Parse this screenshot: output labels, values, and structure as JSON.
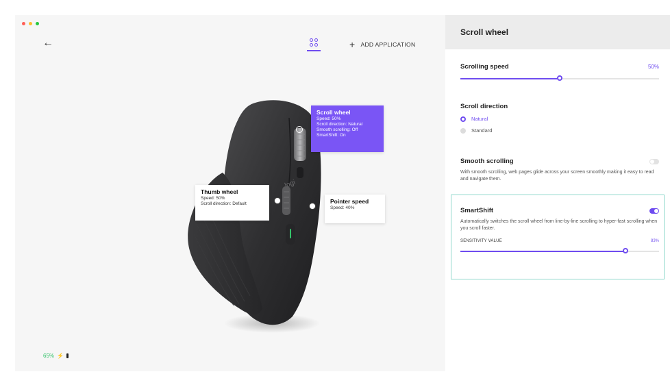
{
  "window": {
    "traffic_lights": [
      "#ff5f57",
      "#febc2e",
      "#28c840"
    ]
  },
  "toolbar": {
    "back_icon": "←",
    "apps_icon": "apps-grid-icon",
    "add_application_label": "ADD APPLICATION"
  },
  "callouts": {
    "scroll_wheel": {
      "title": "Scroll wheel",
      "lines": [
        "Speed: 50%",
        "Scroll direction: Natural",
        "Smooth scrolling: Off",
        "SmartShift: On"
      ]
    },
    "thumb_wheel": {
      "title": "Thumb wheel",
      "lines": [
        "Speed: 50%",
        "Scroll direction: Default"
      ]
    },
    "pointer_speed": {
      "title": "Pointer speed",
      "lines": [
        "Speed: 40%"
      ]
    }
  },
  "device": {
    "logo_text": "logi",
    "battery_percent": "65%"
  },
  "panel": {
    "title": "Scroll wheel",
    "scrolling_speed": {
      "label": "Scrolling speed",
      "value_text": "50%",
      "value": 0.5
    },
    "scroll_direction": {
      "label": "Scroll direction",
      "options": [
        {
          "label": "Natural",
          "selected": true
        },
        {
          "label": "Standard",
          "selected": false
        }
      ]
    },
    "smooth_scrolling": {
      "label": "Smooth scrolling",
      "enabled": false,
      "description": "With smooth scrolling, web pages glide across your screen smoothly making it easy to read and navigate them."
    },
    "smartshift": {
      "label": "SmartShift",
      "enabled": true,
      "description": "Automatically switches the scroll wheel from line-by-line scrolling to hyper-fast scrolling when you scroll faster.",
      "sensitivity_label": "SENSITIVITY VALUE",
      "sensitivity_text": "83%",
      "sensitivity_value": 0.83
    }
  },
  "colors": {
    "accent": "#6f4cf0",
    "highlight_border": "#8fd8cc",
    "battery_green": "#34c36a"
  }
}
